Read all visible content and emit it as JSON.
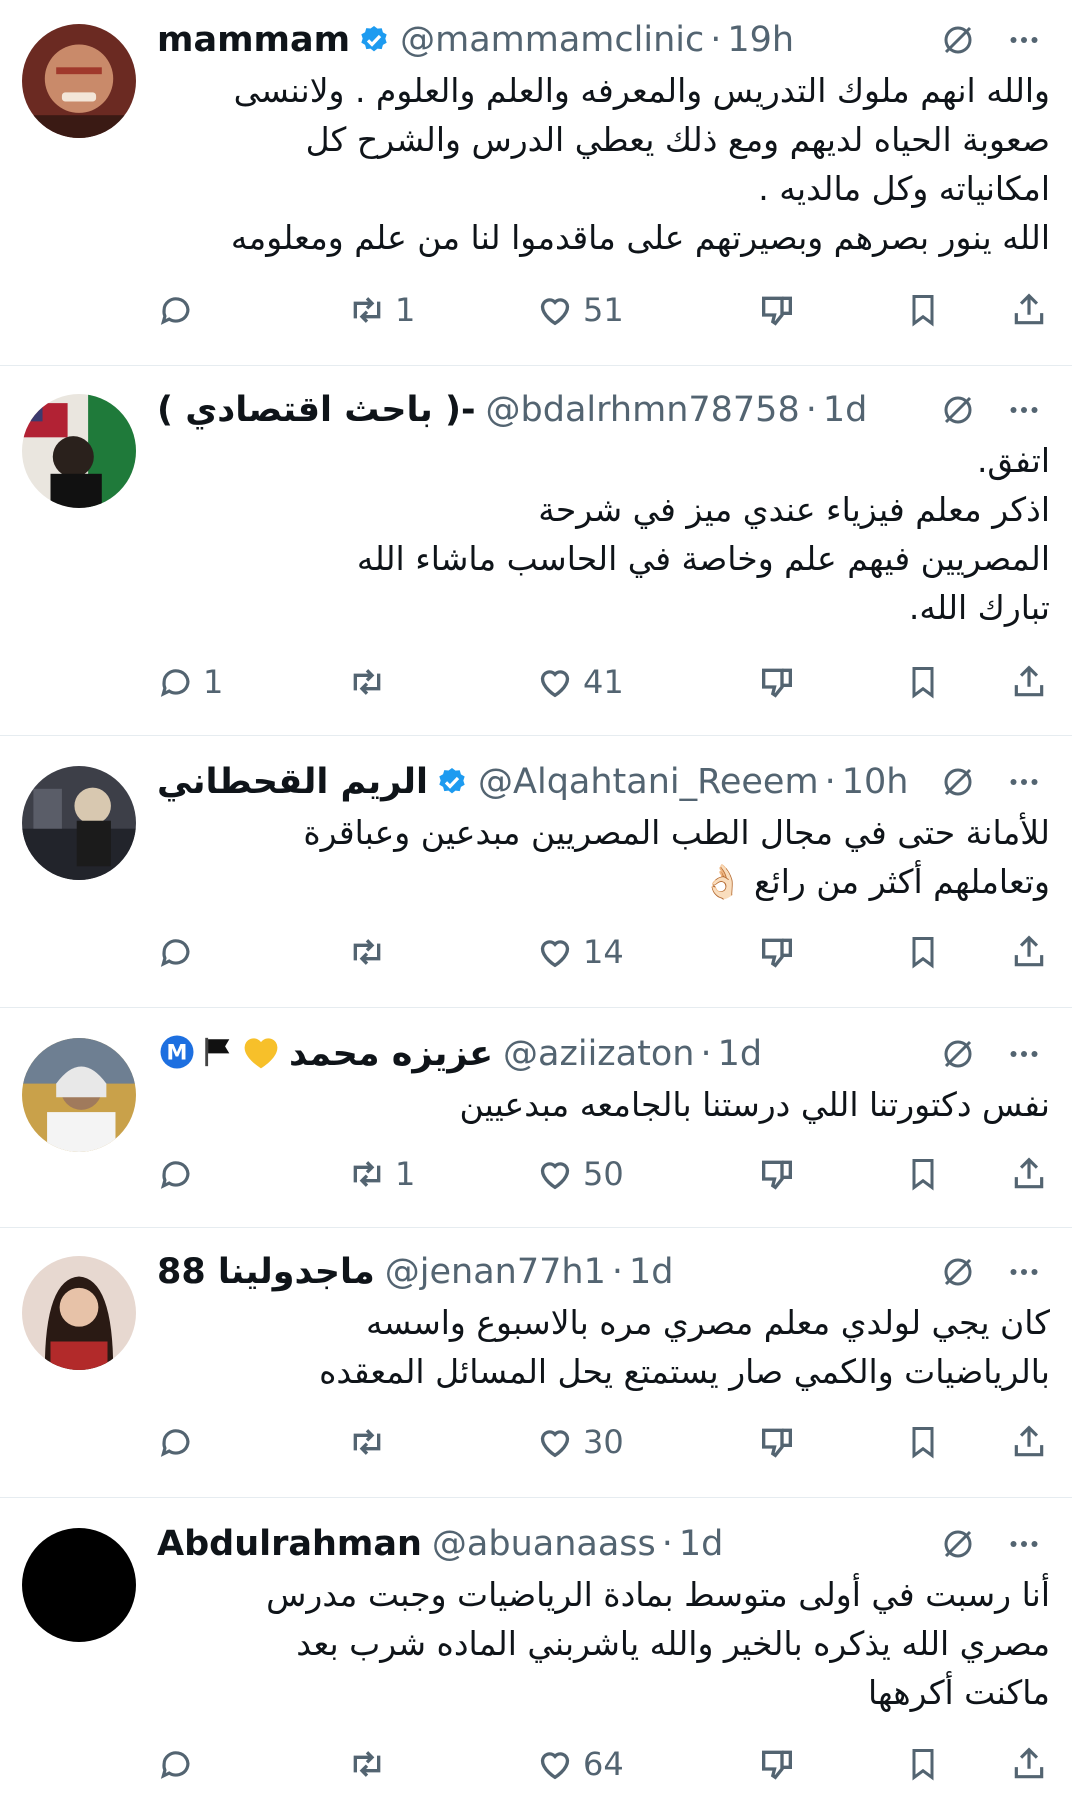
{
  "colors": {
    "verified": "#1d9bf0",
    "secondary": "#536471",
    "divider": "#e6ecf0"
  },
  "tweets": [
    {
      "name": "mammam",
      "verified": true,
      "handle": "@mammamclinic",
      "sep": "·",
      "time": "19h",
      "lines": [
        "والله انهم ملوك التدريس والمعرفه والعلم والعلوم . ولاننسى",
        "صعوبة الحياه لديهم ومع ذلك يعطي الدرس والشرح كل",
        "امكانياته وكل مالديه .",
        "الله ينور بصرهم وبصيرتهم على ماقدموا لنا من علم ومعلومه"
      ],
      "replies": "",
      "retweets": "1",
      "likes": "51"
    },
    {
      "name": "( باحث اقتصادي )-",
      "verified": false,
      "handle": "@bdalrhmn78758",
      "sep": "·",
      "time": "1d",
      "lines": [
        "اتفق.",
        "اذكر معلم فيزياء عندي ميز في شرحة",
        "المصريين فيهم علم وخاصة في الحاسب ماشاء الله",
        "تبارك الله."
      ],
      "replies": "1",
      "retweets": "",
      "likes": "41"
    },
    {
      "name": "الريم القحطاني",
      "verified": true,
      "handle": "@Alqahtani_Reeem",
      "sep": "·",
      "time": "10h",
      "lines": [
        "للأمانة حتى في مجال الطب المصريين مبدعين وعباقرة",
        "وتعاملهم أكثر من رائع 👌🏻"
      ],
      "replies": "",
      "retweets": "",
      "likes": "14"
    },
    {
      "name": "عزيزه محمد",
      "name_badges": [
        "💛",
        "🏴",
        "Ⓜ️"
      ],
      "verified": false,
      "handle": "@aziizaton",
      "sep": "·",
      "time": "1d",
      "lines": [
        "نفس دكتورتنا اللي درستنا بالجامعه مبدعيين"
      ],
      "replies": "",
      "retweets": "1",
      "likes": "50"
    },
    {
      "name": "ماجدولينا 88",
      "verified": false,
      "handle": "@jenan77h1",
      "sep": "·",
      "time": "1d",
      "lines": [
        "كان يجي لولدي معلم مصري مره بالاسبوع واسسه",
        "بالرياضيات والكمي صار يستمتع يحل المسائل المعقده"
      ],
      "replies": "",
      "retweets": "",
      "likes": "30"
    },
    {
      "name": "Abdulrahman",
      "verified": false,
      "handle": "@abuanaass",
      "sep": "·",
      "time": "1d",
      "lines": [
        "أنا رسبت في أولى متوسط بمادة الرياضيات  وجبت مدرس",
        "مصري الله يذكره بالخير والله ياشربني الماده شرب بعد",
        "ماكنت أكرهها"
      ],
      "replies": "",
      "retweets": "",
      "likes": "64"
    }
  ]
}
